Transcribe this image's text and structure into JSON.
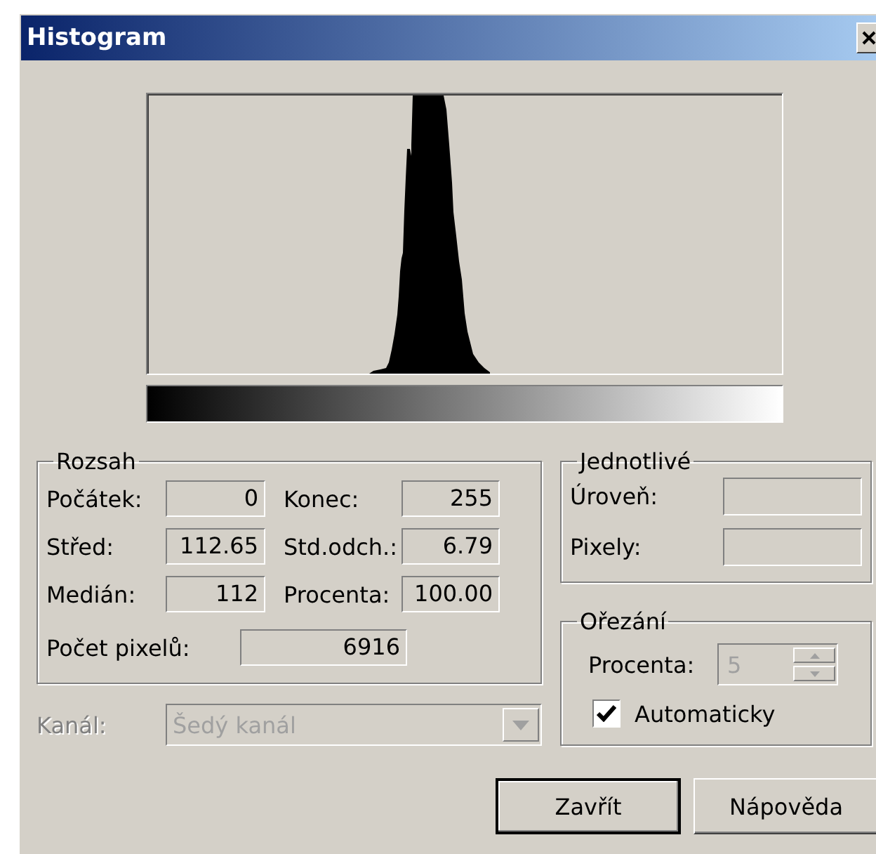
{
  "window": {
    "title": "Histogram"
  },
  "range": {
    "title": "Rozsah",
    "fields": [
      {
        "label": "Počátek:",
        "value": "0"
      },
      {
        "label": "Konec:",
        "value": "255"
      },
      {
        "label": "Střed:",
        "value": "112.65"
      },
      {
        "label": "Std.odch.:",
        "value": "6.79"
      },
      {
        "label": "Medián:",
        "value": "112"
      },
      {
        "label": "Procenta:",
        "value": "100.00"
      }
    ],
    "pixel_count": {
      "label": "Počet pixelů:",
      "value": "6916"
    }
  },
  "single": {
    "title": "Jednotlivé",
    "fields": [
      {
        "label": "Úroveň:"
      },
      {
        "label": "Pixely:"
      }
    ]
  },
  "clipping": {
    "title": "Ořezání",
    "percent": {
      "label": "Procenta:",
      "value": "5",
      "disabled": true
    },
    "auto": {
      "label": "Automaticky",
      "checked": true
    }
  },
  "channel": {
    "label": "Kanál:",
    "value": "Šedý kanál",
    "disabled": true
  },
  "buttons": [
    {
      "label": "Zavřít",
      "default": true
    },
    {
      "label": "Nápověda",
      "default": false
    }
  ]
}
